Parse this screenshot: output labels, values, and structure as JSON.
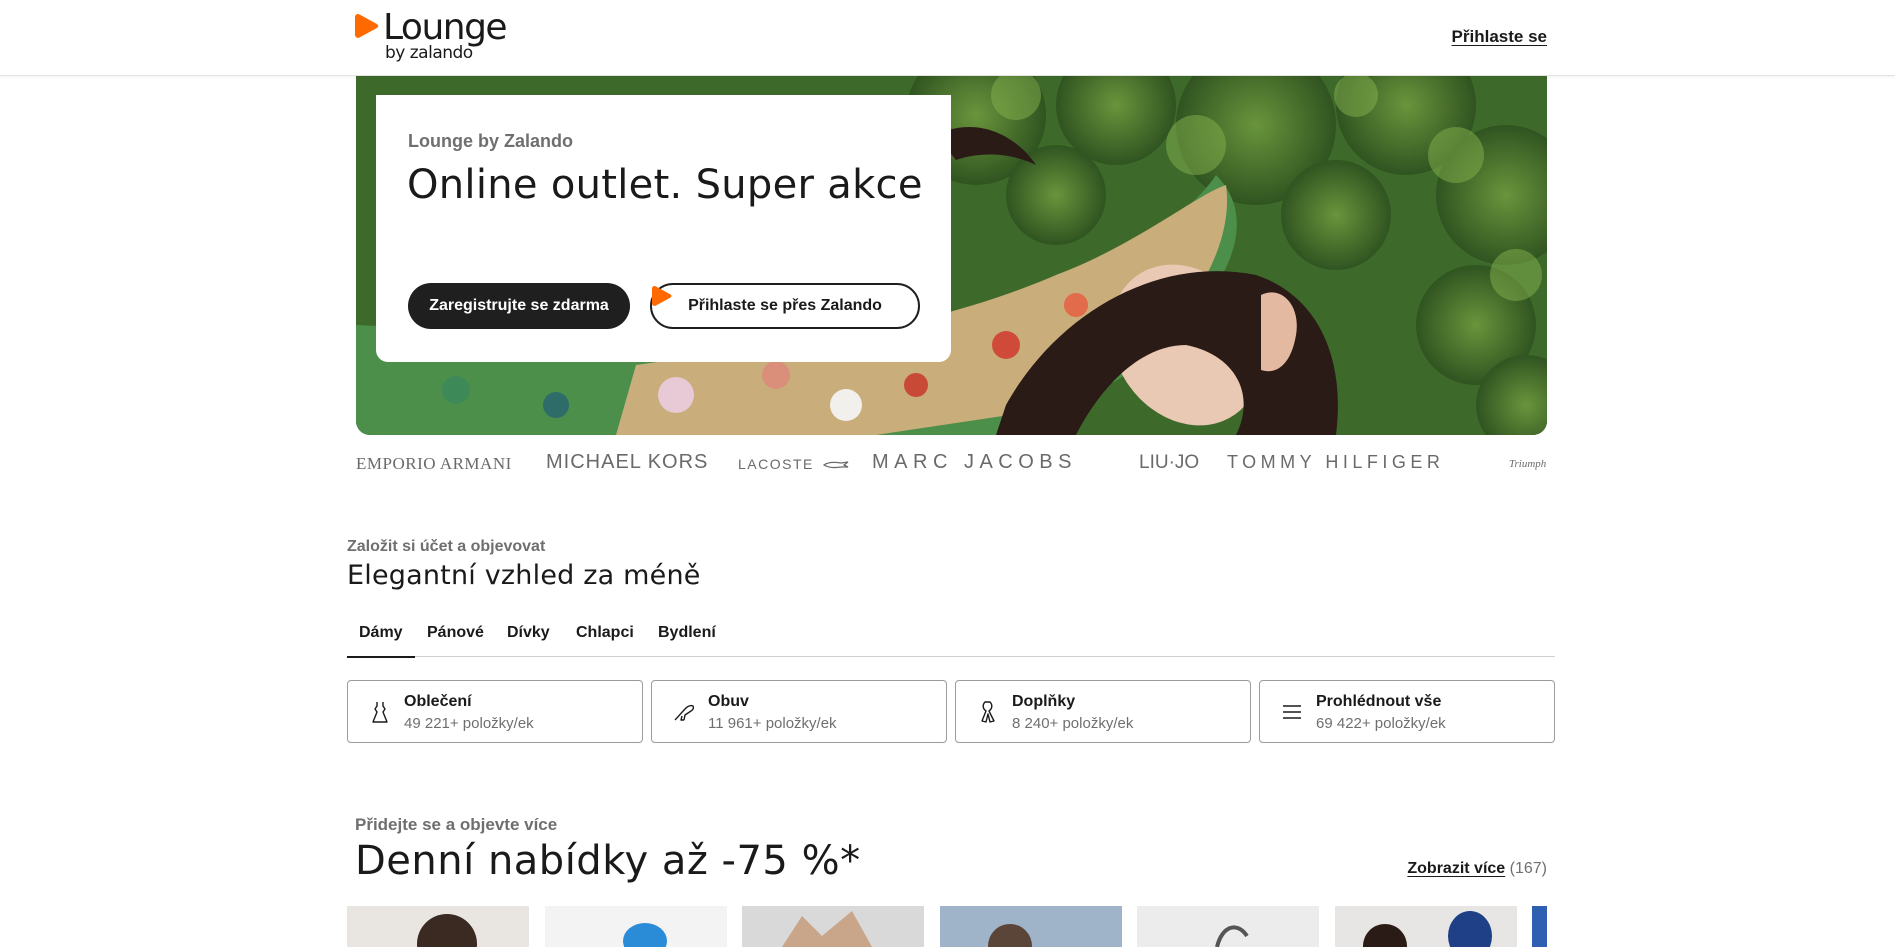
{
  "header": {
    "logo_word": "Lounge",
    "logo_sub": "by zalando",
    "login_link": "Přihlaste se"
  },
  "hero": {
    "eyebrow": "Lounge by Zalando",
    "title": "Online outlet. Super akce",
    "register_button": "Zaregistrujte se zdarma",
    "zalando_button": "Přihlaste se přes Zalando"
  },
  "brands": [
    "EMPORIO ARMANI",
    "MICHAEL KORS",
    "LACOSTE",
    "MARC JACOBS",
    "LIU·JO",
    "TOMMY HILFIGER",
    "Triumph"
  ],
  "section_categories": {
    "eyebrow": "Založit si účet a objevovat",
    "title": "Elegantní vzhled za méně",
    "tabs": [
      {
        "label": "Dámy",
        "active": true
      },
      {
        "label": "Pánové",
        "active": false
      },
      {
        "label": "Dívky",
        "active": false
      },
      {
        "label": "Chlapci",
        "active": false
      },
      {
        "label": "Bydlení",
        "active": false
      }
    ],
    "cards": [
      {
        "name": "Oblečení",
        "count": "49 221+ položky/ek",
        "icon": "dress-icon"
      },
      {
        "name": "Obuv",
        "count": "11 961+ položky/ek",
        "icon": "shoe-icon"
      },
      {
        "name": "Doplňky",
        "count": "8 240+ položky/ek",
        "icon": "scarf-icon"
      },
      {
        "name": "Prohlédnout vše",
        "count": "69 422+ položky/ek",
        "icon": "list-icon"
      }
    ]
  },
  "section_deals": {
    "eyebrow": "Přidejte se a objevte více",
    "title": "Denní nabídky až -75 %*",
    "show_more": "Zobrazit více",
    "count": "(167)"
  },
  "colors": {
    "brand_orange": "#ff6900",
    "text_dark": "#1a1a1a",
    "text_muted": "#6f6f6f"
  }
}
